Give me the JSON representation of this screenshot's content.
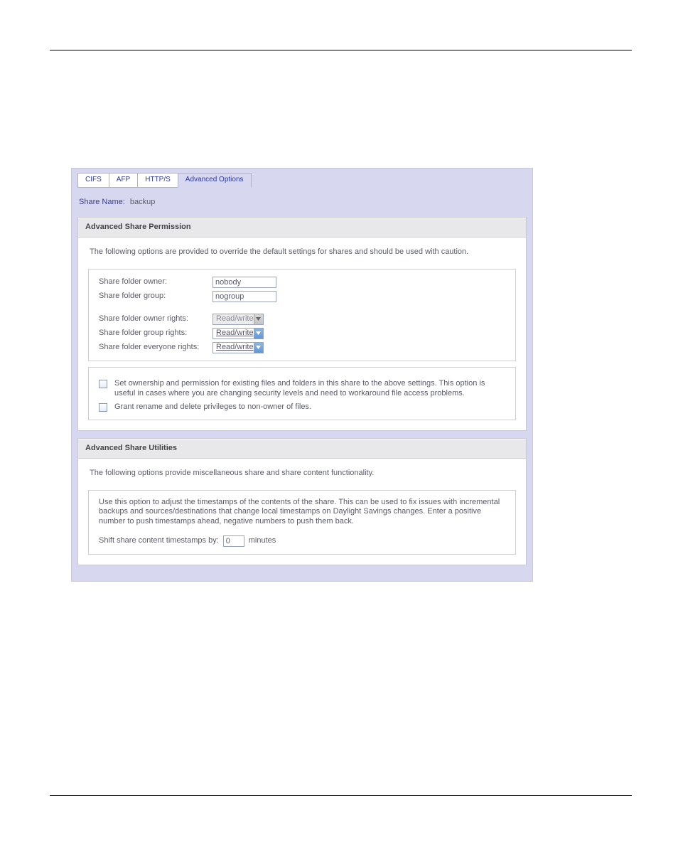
{
  "tabs": {
    "items": [
      {
        "label": "CIFS"
      },
      {
        "label": "AFP"
      },
      {
        "label": "HTTP/S"
      },
      {
        "label": "Advanced Options"
      }
    ]
  },
  "share_name": {
    "label": "Share Name:",
    "value": "backup"
  },
  "perm": {
    "title": "Advanced Share Permission",
    "desc": "The following options are provided to override the default settings for shares and should be used with caution.",
    "rows": {
      "owner_label": "Share folder owner:",
      "owner_value": "nobody",
      "group_label": "Share folder group:",
      "group_value": "nogroup",
      "owner_rights_label": "Share folder owner rights:",
      "owner_rights_value": "Read/write",
      "group_rights_label": "Share folder group rights:",
      "group_rights_value": "Read/write",
      "everyone_rights_label": "Share folder everyone rights:",
      "everyone_rights_value": "Read/write"
    },
    "checks": {
      "set_ownership": "Set ownership and permission for existing files and folders in this share to the above settings. This option is useful in cases where you are changing security levels and need to workaround file access problems.",
      "grant_non_owner": "Grant rename and delete privileges to non-owner of files."
    }
  },
  "utils": {
    "title": "Advanced Share Utilities",
    "desc": "The following options provide miscellaneous share and share content functionality.",
    "box_desc": "Use this option to adjust the timestamps of the contents of the share. This can be used to fix issues with incremental backups and sources/destinations that change local timestamps on Daylight Savings changes. Enter a positive number to push timestamps ahead, negative numbers to push them back.",
    "shift_label": "Shift share content timestamps by:",
    "shift_value": "0",
    "shift_units": "minutes"
  }
}
